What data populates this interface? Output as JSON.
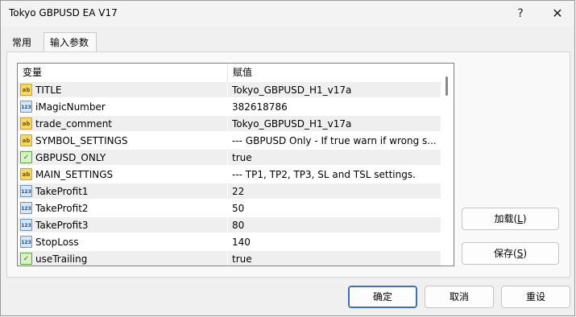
{
  "window": {
    "title": "Tokyo GBPUSD EA V17",
    "help_glyph": "?",
    "close_glyph": "✕"
  },
  "tabs": [
    {
      "label": "常用"
    },
    {
      "label": "输入参数"
    }
  ],
  "grid": {
    "columns": {
      "variable": "变量",
      "value": "赋值"
    },
    "rows": [
      {
        "type": "string",
        "icon": "ab",
        "name": "TITLE",
        "value": "Tokyo_GBPUSD_H1_v17a"
      },
      {
        "type": "integer",
        "icon": "123",
        "name": "iMagicNumber",
        "value": "382618786"
      },
      {
        "type": "string",
        "icon": "ab",
        "name": "trade_comment",
        "value": "Tokyo_GBPUSD_H1_v17a"
      },
      {
        "type": "string",
        "icon": "ab",
        "name": "SYMBOL_SETTINGS",
        "value": "--- GBPUSD Only - If true warn if wrong s..."
      },
      {
        "type": "bool",
        "icon": "✓",
        "name": "GBPUSD_ONLY",
        "value": "true"
      },
      {
        "type": "string",
        "icon": "ab",
        "name": "MAIN_SETTINGS",
        "value": "--- TP1, TP2, TP3, SL and TSL settings."
      },
      {
        "type": "integer",
        "icon": "123",
        "name": "TakeProfit1",
        "value": "22"
      },
      {
        "type": "integer",
        "icon": "123",
        "name": "TakeProfit2",
        "value": "50"
      },
      {
        "type": "integer",
        "icon": "123",
        "name": "TakeProfit3",
        "value": "80"
      },
      {
        "type": "integer",
        "icon": "123",
        "name": "StopLoss",
        "value": "140"
      },
      {
        "type": "bool",
        "icon": "✓",
        "name": "useTrailing",
        "value": "true"
      }
    ]
  },
  "side_buttons": {
    "load": {
      "label": "加载(",
      "key": "L",
      "close": ")"
    },
    "save": {
      "label": "保存(",
      "key": "S",
      "close": ")"
    }
  },
  "footer_buttons": {
    "ok": "确定",
    "cancel": "取消",
    "reset": "重设"
  }
}
